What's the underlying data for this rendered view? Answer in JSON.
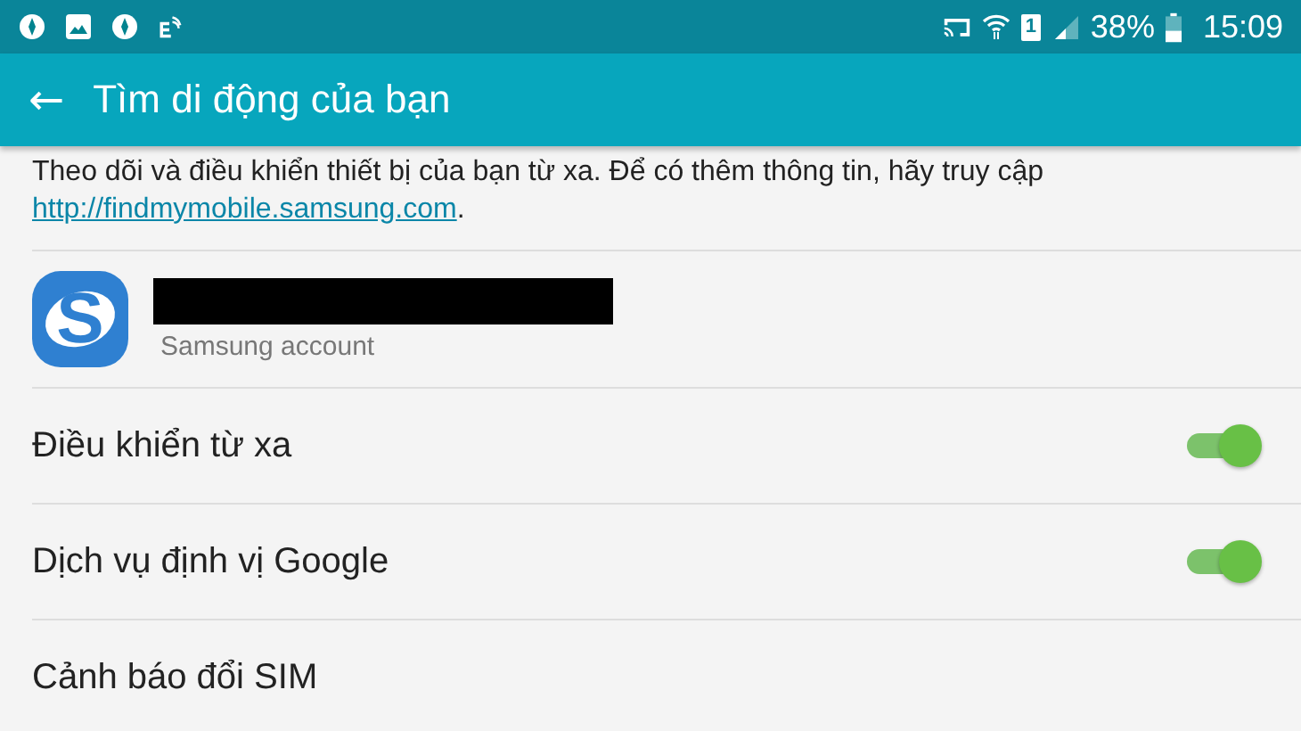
{
  "status_bar": {
    "sim_slot": "1",
    "battery": "38%",
    "time": "15:09"
  },
  "app_bar": {
    "back": "←",
    "title": "Tìm di động của bạn"
  },
  "intro": {
    "text": "Theo dõi và điều khiển thiết bị của bạn từ xa. Để có thêm thông tin, hãy truy cập",
    "link": "http://findmymobile.samsung.com",
    "after": "."
  },
  "account": {
    "logo_letter": "S",
    "subtitle": "Samsung account"
  },
  "settings": [
    {
      "label": "Điều khiển từ xa",
      "kind": "switch",
      "on": true
    },
    {
      "label": "Dịch vụ định vị Google",
      "kind": "switch",
      "on": true
    },
    {
      "label": "Cảnh báo đổi SIM",
      "kind": "plain"
    }
  ]
}
